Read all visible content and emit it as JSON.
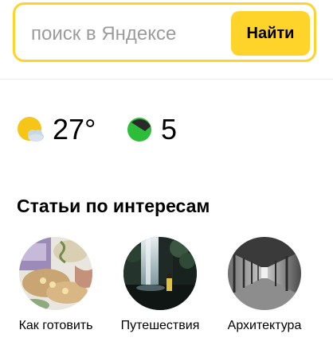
{
  "search": {
    "placeholder": "поиск в Яндексе",
    "button_label": "Найти"
  },
  "informers": {
    "weather": {
      "temperature": "27°",
      "icon": "partly-cloudy-sun-icon"
    },
    "traffic": {
      "score": "5",
      "icon": "traffic-jam-icon"
    }
  },
  "interests": {
    "title": "Статьи по интересам",
    "items": [
      {
        "label": "Как готовить",
        "image": "cooking-photo"
      },
      {
        "label": "Путешествия",
        "image": "waterfall-photo"
      },
      {
        "label": "Архитектура",
        "image": "corridor-photo"
      }
    ]
  },
  "colors": {
    "accent": "#fed42b",
    "weather_sun": "#f5c518",
    "traffic_green": "#2ebd3a"
  }
}
